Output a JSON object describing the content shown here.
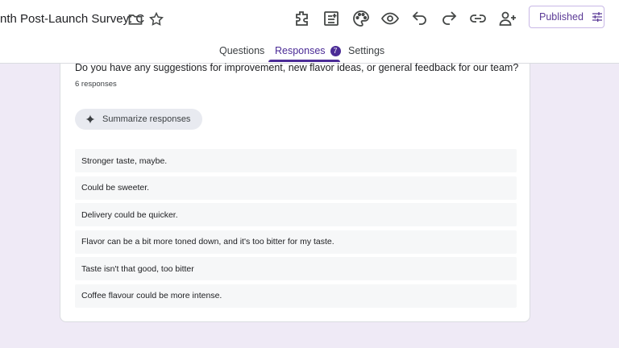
{
  "header": {
    "doc_title": "nth Post-Launch Survey: C",
    "publish_label": "Published"
  },
  "tabs": [
    {
      "label": "Questions"
    },
    {
      "label": "Responses",
      "badge": "7"
    },
    {
      "label": "Settings"
    }
  ],
  "question": {
    "title": "Do you have any suggestions for improvement, new flavor ideas, or general feedback for our team?",
    "count": "6 responses",
    "summarize_label": "Summarize responses",
    "responses": [
      "Stronger taste, maybe.",
      "Could be sweeter.",
      "Delivery could be quicker.",
      "Flavor can be a bit more toned down, and it's too bitter for my taste.",
      "Taste isn't that good, too bitter",
      "Coffee flavour could be more intense."
    ]
  },
  "colors": {
    "accent": "#4b2b96",
    "background": "#efeaf6"
  },
  "icons": [
    "folder-icon",
    "star-icon",
    "addon-icon",
    "form-template-icon",
    "palette-icon",
    "preview-icon",
    "undo-icon",
    "redo-icon",
    "link-icon",
    "add-collaborator-icon",
    "settings-sliders-icon",
    "sparkle-icon"
  ]
}
